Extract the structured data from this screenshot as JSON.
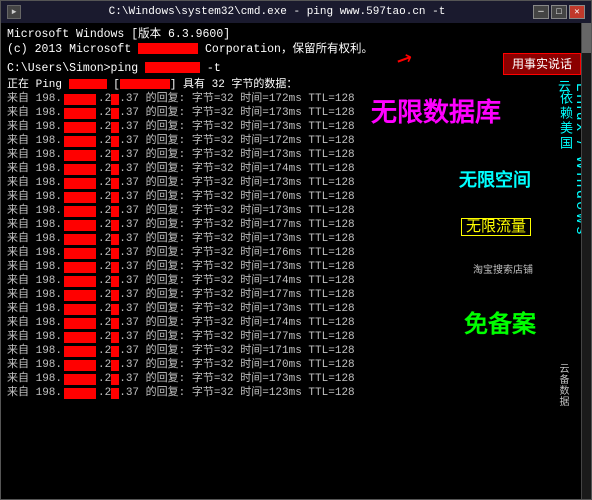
{
  "window": {
    "title": "C:\\Windows\\system32\\cmd.exe - ping  www.597tao.cn -t",
    "icon": "►"
  },
  "controls": {
    "minimize": "─",
    "maximize": "□",
    "close": "✕"
  },
  "header_lines": [
    "Microsoft Windows [版本 6.3.9600]",
    "(c) 2013 Microsoft Corporation。保留所有权利。",
    "",
    "C:\\Users\\Simon>ping              -t"
  ],
  "ping_status": "正在 Ping                    [198.          ] 具有 32 字节的数据：",
  "ping_rows": [
    "来自 198.  .2  .37 的回复: 字节=32 时间=172ms TTL=128",
    "来自 198.  .2  .37 的回复: 字节=32 时间=173ms TTL=128",
    "来自 198.  .2  .37 的回复: 字节=32 时间=173ms TTL=128",
    "来自 198.  .2  .37 的回复: 字节=32 时间=172ms TTL=128",
    "来自 198.  .2  .37 的回复: 字节=32 时间=173ms TTL=128",
    "来自 198.  .2  .37 的回复: 字节=32 时间=174ms TTL=128",
    "来自 198.  .2  .37 的回复: 字节=32 时间=173ms TTL=128",
    "来自 198.  .2  .37 的回复: 字节=32 时间=170ms TTL=128",
    "来自 198.  .2  .37 的回复: 字节=32 时间=173ms TTL=128",
    "来自 198.  .2  .37 的回复: 字节=32 时间=177ms TTL=128",
    "来自 198.  .2  .37 的回复: 字节=32 时间=173ms TTL=128",
    "来自 198.  .2  .37 的回复: 字节=32 时间=176ms TTL=128",
    "来自 198.  .2  .37 的回复: 字节=32 时间=173ms TTL=128",
    "来自 198.  .2  .37 的回复: 字节=32 时间=174ms TTL=128",
    "来自 198.  .2  .37 的回复: 字节=32 时间=177ms TTL=128",
    "来自 198.  .2  .37 的回复: 字节=32 时间=173ms TTL=128",
    "来自 198.  .2  .37 的回复: 字节=32 时间=174ms TTL=128",
    "来自 198.  .2  .37 的回复: 字节=32 时间=177ms TTL=128",
    "来自 198.  .2  .37 的回复: 字节=32 时间=171ms TTL=128",
    "来自 198.  .2  .37 的回复: 字节=32 时间=170ms TTL=128",
    "来自 198.  .2  .37 的回复: 字节=32 时间=173ms TTL=128",
    "来自 198.  .2  .37 的回复: 字节=32 时间=123ms TTL=128"
  ],
  "ads": {
    "top_right_label": "用事实说话",
    "cloud_title": "云",
    "rely_us": "依赖美国",
    "linux_windows": "Linux / Windows",
    "unlimited_space": "无限空间",
    "unlimited_db": "无限数据库",
    "unlimited_flow": "无限流量",
    "free_backup": "免备案",
    "taobao": "淘宝搜索店铺",
    "backup_data": "云备数据"
  }
}
